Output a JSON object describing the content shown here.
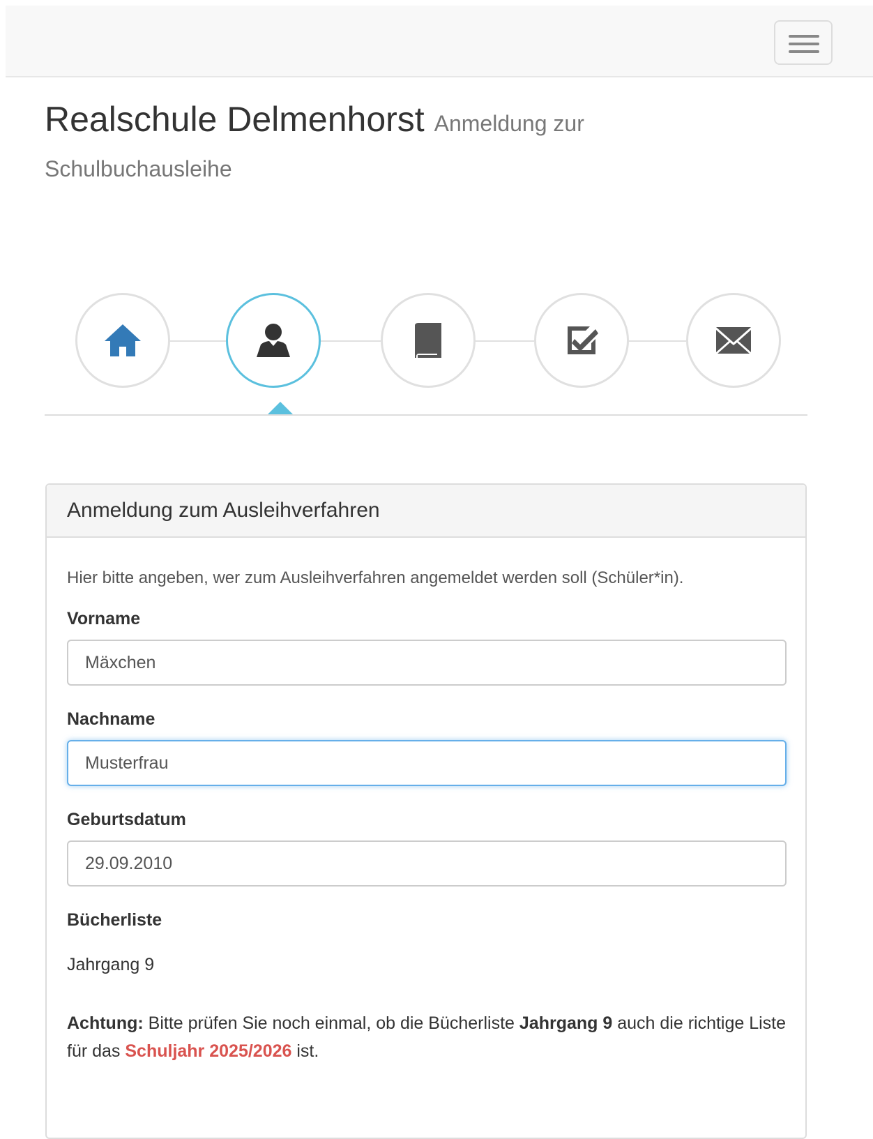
{
  "navbar": {
    "toggle_icon": "hamburger-menu-icon"
  },
  "header": {
    "title": "Realschule Delmenhorst",
    "subtitle_part1": "Anmeldung zur",
    "subtitle_part2": "Schulbuchausleihe"
  },
  "steps": [
    {
      "icon": "home-icon",
      "color": "#337ab7",
      "active": false
    },
    {
      "icon": "user-icon",
      "color": "#333333",
      "active": true
    },
    {
      "icon": "book-icon",
      "color": "#555555",
      "active": false
    },
    {
      "icon": "check-square-icon",
      "color": "#555555",
      "active": false
    },
    {
      "icon": "envelope-icon",
      "color": "#555555",
      "active": false
    }
  ],
  "panel": {
    "title": "Anmeldung zum Ausleihverfahren",
    "intro": "Hier bitte angeben, wer zum Ausleihverfahren angemeldet werden soll (Schüler*in).",
    "fields": {
      "vorname": {
        "label": "Vorname",
        "value": "Mäxchen"
      },
      "nachname": {
        "label": "Nachname",
        "value": "Musterfrau"
      },
      "geburtsdatum": {
        "label": "Geburtsdatum",
        "value": "29.09.2010"
      }
    },
    "buecherliste": {
      "label": "Bücherliste",
      "value": "Jahrgang 9"
    },
    "notice": {
      "prefix": "Achtung:",
      "text1": " Bitte prüfen Sie noch einmal, ob die Bücherliste ",
      "jahrgang": "Jahrgang 9",
      "text2": " auch die richtige Liste für das ",
      "schuljahr": "Schuljahr 2025/2026",
      "text3": " ist."
    }
  },
  "colors": {
    "accent": "#5bc0de",
    "primary": "#337ab7",
    "warning_red": "#d9534f"
  }
}
